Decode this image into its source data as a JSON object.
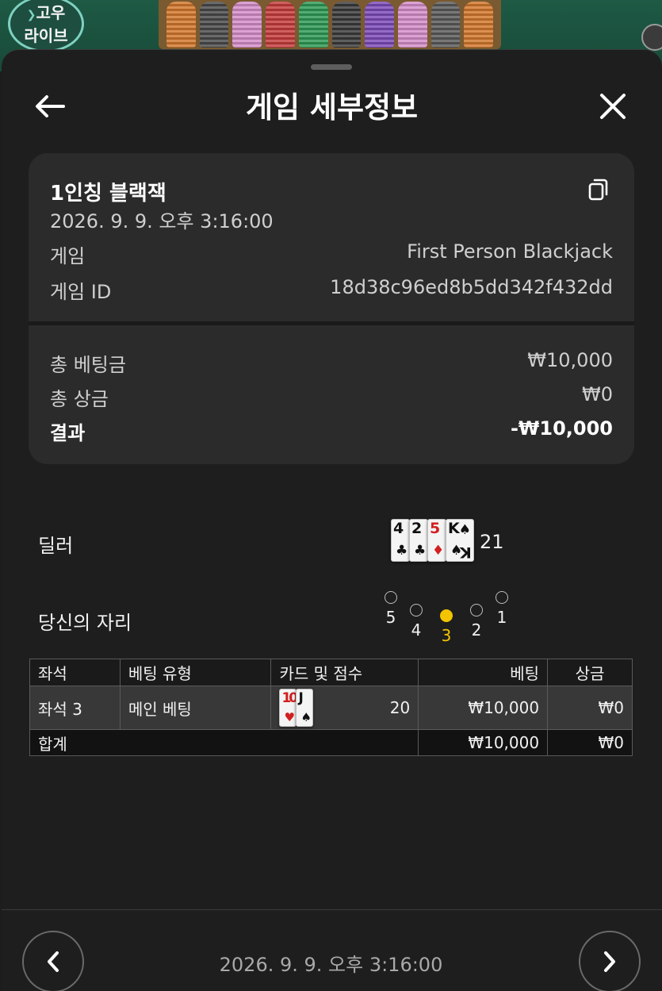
{
  "background": {
    "logo_text_line1": "고우",
    "logo_text_line2": "라이브",
    "chip_colors": [
      "#d2782c",
      "#4a4a4a",
      "#d58ec9",
      "#c63c3c",
      "#2f9a55",
      "#3a3a3a",
      "#7d4bb8",
      "#d58ec9",
      "#5a5a5a",
      "#d2782c"
    ]
  },
  "header": {
    "title": "게임 세부정보",
    "back_icon": "arrow-left-icon",
    "close_icon": "close-icon"
  },
  "summary": {
    "title": "1인칭 블랙잭",
    "datetime": "2026. 9. 9. 오후 3:16:00",
    "copy_icon": "copy-icon",
    "rows": [
      {
        "label": "게임",
        "value": "First Person Blackjack"
      },
      {
        "label": "게임 ID",
        "value": "18d38c96ed8b5dd342f432dd"
      }
    ],
    "totals": [
      {
        "label": "총 베팅금",
        "value": "₩10,000"
      },
      {
        "label": "총 상금",
        "value": "₩0"
      },
      {
        "label": "결과",
        "value": "-₩10,000"
      }
    ]
  },
  "dealer": {
    "label": "딜러",
    "cards": [
      {
        "rank": "4",
        "suit": "♣",
        "color": "black"
      },
      {
        "rank": "2",
        "suit": "♣",
        "color": "black"
      },
      {
        "rank": "5",
        "suit": "♦",
        "color": "red"
      },
      {
        "rank": "K",
        "suit": "♠",
        "color": "black"
      }
    ],
    "score": "21"
  },
  "seats": {
    "label": "당신의 자리",
    "items": [
      {
        "number": "5",
        "active": false
      },
      {
        "number": "4",
        "active": false
      },
      {
        "number": "3",
        "active": true
      },
      {
        "number": "2",
        "active": false
      },
      {
        "number": "1",
        "active": false
      }
    ],
    "active_color": "#f3c400"
  },
  "table": {
    "headers": [
      "좌석",
      "베팅 유형",
      "카드 및 점수",
      "베팅",
      "상금"
    ],
    "rows": [
      {
        "seat": "좌석 3",
        "bet_type": "메인 베팅",
        "cards": [
          {
            "rank": "10",
            "suit": "♥",
            "color": "red"
          },
          {
            "rank": "J",
            "suit": "♠",
            "color": "black"
          }
        ],
        "score": "20",
        "bet": "₩10,000",
        "payout": "₩0"
      }
    ],
    "total": {
      "label": "합계",
      "bet": "₩10,000",
      "payout": "₩0"
    }
  },
  "footer": {
    "datetime": "2026. 9. 9. 오후 3:16:00",
    "prev_icon": "chevron-left-icon",
    "next_icon": "chevron-right-icon"
  }
}
